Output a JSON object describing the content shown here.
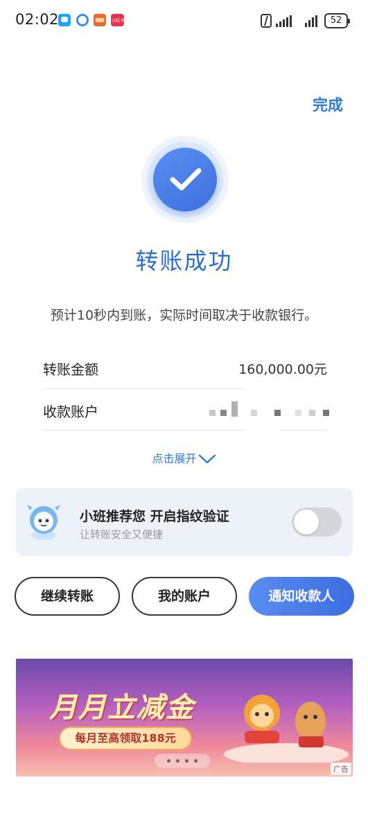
{
  "status_bar": {
    "time": "02:02",
    "battery": "52",
    "icons": [
      "message-app-icon",
      "globe-app-icon",
      "card-app-icon",
      "red-app-icon",
      "nfc-icon",
      "signal-icon",
      "battery-icon"
    ],
    "red_app_label": "小红书"
  },
  "header": {
    "done_label": "完成"
  },
  "result": {
    "icon": "check-icon",
    "title": "转账成功",
    "subtitle": "预计10秒内到账，实际时间取决于收款银行。"
  },
  "details": {
    "amount_label": "转账金额",
    "amount_value": "160,000.00元",
    "account_label": "收款账户"
  },
  "expand": {
    "label": "点击展开"
  },
  "promo": {
    "title": "小班推荐您 开启指纹验证",
    "subtitle": "让转账安全又便捷",
    "toggle_on": false
  },
  "buttons": {
    "continue": "继续转账",
    "my_account": "我的账户",
    "notify": "通知收款人"
  },
  "ad": {
    "title": "月月立减金",
    "pill": "每月至高领取188元",
    "tag": "广告"
  },
  "colors": {
    "accent": "#2e7ad6",
    "primary_button": "#4a7de8",
    "promo_bg": "#edf2f9"
  }
}
